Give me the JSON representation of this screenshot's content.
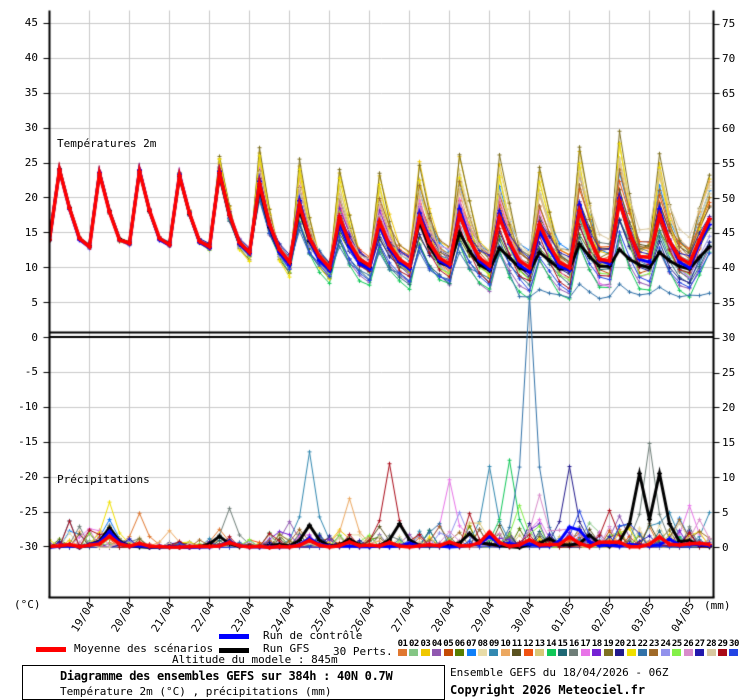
{
  "ui": {
    "panel_temp_label": "Températures 2m",
    "panel_precip_label": "Précipitations",
    "unit_left": "(°C)",
    "unit_right": "(mm)",
    "legend_mean": "Moyenne des scénarios",
    "legend_control": "Run de contrôle",
    "legend_gfs": "Run GFS",
    "legend_perts": "30 Perts.",
    "altitude": "Altitude du modele : 845m",
    "title": "Diagramme des ensembles GEFS sur 384h : 40N 0.7W",
    "subtitle": "Température 2m (°C) , précipitations (mm)",
    "run_info": "Ensemble GEFS du 18/04/2026 - 06Z",
    "copyright": "Copyright 2026 Meteociel.fr"
  },
  "chart_data": {
    "type": "line",
    "title": "Diagramme des ensembles GEFS sur 384h : 40N 0.7W",
    "subtitle": "Température 2m (°C) , précipitations (mm)",
    "x": {
      "start": "18/04 06Z",
      "step_hours": 6,
      "dates": [
        "19/04",
        "20/04",
        "21/04",
        "22/04",
        "23/04",
        "24/04",
        "25/04",
        "26/04",
        "27/04",
        "28/04",
        "29/04",
        "30/04",
        "01/05",
        "02/05",
        "03/05",
        "04/05"
      ]
    },
    "temp_axis": {
      "label": "(°C)",
      "min": -30,
      "max": 45,
      "tick_values": [
        45,
        40,
        35,
        30,
        25,
        20,
        15,
        10,
        5,
        0,
        -5,
        -10,
        -15,
        -20,
        -25,
        -30
      ]
    },
    "precip_axis": {
      "label": "(mm)",
      "min": 0,
      "max": 75,
      "tick_values": [
        75,
        70,
        65,
        60,
        55,
        50,
        45,
        40,
        35,
        30,
        25,
        20,
        15,
        10,
        5,
        0
      ]
    },
    "grid": true,
    "series": {
      "mean": {
        "label": "Moyenne des scénarios",
        "color": "#ff0000",
        "width": 3.5,
        "temp": [
          14.8,
          14.0,
          24.0,
          18.5,
          14.2,
          13.0,
          23.5,
          18.0,
          14.0,
          13.5,
          23.8,
          18.2,
          14.2,
          13.3,
          23.2,
          17.8,
          13.8,
          13.0,
          23.6,
          17.6,
          13.6,
          12.2,
          22.0,
          16.2,
          12.6,
          10.8,
          19.0,
          14.2,
          11.6,
          10.0,
          17.2,
          13.6,
          11.2,
          10.3,
          16.6,
          13.2,
          11.2,
          10.2,
          17.2,
          13.6,
          11.4,
          10.5,
          17.6,
          14.0,
          11.4,
          10.3,
          17.2,
          13.6,
          11.0,
          10.0,
          16.2,
          13.2,
          10.8,
          10.0,
          18.2,
          14.2,
          11.2,
          11.0,
          19.5,
          15.0,
          11.6,
          11.5,
          17.6,
          13.8,
          11.4,
          10.6,
          14.0,
          17.0
        ],
        "precip_events": [
          [
            1.5,
            1.6
          ],
          [
            2.3,
            0.6
          ],
          [
            4.5,
            0.7
          ],
          [
            6.5,
            1.0
          ],
          [
            7.5,
            0.8
          ],
          [
            8.6,
            0.7
          ],
          [
            10.1,
            0.8
          ],
          [
            11.0,
            2.2
          ],
          [
            12.1,
            1.1
          ],
          [
            13.1,
            1.5
          ],
          [
            14.1,
            0.8
          ],
          [
            15.3,
            1.5
          ],
          [
            16.2,
            0.6
          ]
        ]
      },
      "control": {
        "label": "Run de contrôle",
        "color": "#0000ff",
        "width": 3,
        "temp": [
          14.8,
          14.0,
          24.0,
          18.4,
          14.0,
          13.0,
          23.6,
          18.0,
          14.0,
          13.4,
          24.0,
          18.2,
          14.0,
          13.2,
          23.4,
          17.8,
          13.6,
          12.8,
          23.8,
          17.6,
          13.4,
          12.0,
          22.4,
          16.0,
          12.2,
          10.4,
          19.6,
          14.0,
          11.0,
          9.6,
          16.4,
          13.0,
          10.6,
          9.8,
          16.0,
          12.8,
          10.8,
          9.8,
          17.8,
          13.8,
          11.0,
          10.2,
          18.4,
          14.2,
          11.0,
          9.8,
          17.8,
          13.4,
          10.4,
          9.4,
          15.2,
          12.6,
          10.2,
          9.6,
          19.0,
          14.4,
          11.0,
          10.6,
          20.0,
          15.0,
          11.2,
          10.8,
          18.4,
          13.8,
          10.8,
          10.0,
          13.5,
          16.2
        ],
        "precip_events": [
          [
            1.5,
            2.3
          ],
          [
            4.4,
            0.8
          ],
          [
            6.5,
            1.3
          ],
          [
            9.0,
            0.6
          ],
          [
            11.1,
            1.6
          ],
          [
            13.0,
            2.9
          ],
          [
            13.3,
            2.5
          ],
          [
            15.4,
            1.2
          ],
          [
            16.0,
            0.5
          ]
        ]
      },
      "gfs": {
        "label": "Run GFS",
        "color": "#000000",
        "width": 3,
        "temp": [
          14.8,
          14.0,
          24.1,
          18.6,
          14.2,
          13.1,
          23.6,
          18.1,
          14.1,
          13.5,
          23.9,
          18.1,
          14.1,
          13.3,
          23.1,
          17.7,
          13.7,
          13.0,
          23.5,
          17.5,
          13.4,
          12.1,
          21.6,
          15.8,
          12.2,
          10.6,
          18.4,
          13.8,
          11.2,
          9.8,
          16.8,
          13.2,
          10.8,
          10.0,
          16.2,
          12.8,
          10.8,
          10.0,
          16.6,
          13.0,
          10.8,
          10.2,
          15.0,
          12.4,
          10.4,
          9.6,
          12.8,
          11.4,
          10.0,
          9.4,
          12.2,
          11.0,
          9.8,
          9.8,
          13.4,
          11.6,
          10.2,
          10.2,
          12.6,
          11.2,
          10.4,
          10.0,
          12.2,
          11.0,
          10.2,
          9.8,
          11.5,
          13.0
        ],
        "precip_events": [
          [
            1.5,
            2.8
          ],
          [
            4.35,
            1.6
          ],
          [
            6.55,
            3.2
          ],
          [
            7.5,
            1.2
          ],
          [
            8.75,
            3.4
          ],
          [
            10.4,
            2.0
          ],
          [
            12.5,
            1.3
          ],
          [
            13.6,
            1.8
          ],
          [
            14.8,
            10.6
          ],
          [
            15.1,
            4.0
          ],
          [
            15.35,
            10.6
          ],
          [
            16.1,
            1.0
          ]
        ]
      }
    },
    "members": [
      {
        "n": "01",
        "c": "#e07830",
        "a": 1.05,
        "o": 1.2
      },
      {
        "n": "02",
        "c": "#84c684",
        "a": 0.95,
        "o": -1.0
      },
      {
        "n": "03",
        "c": "#f0c800",
        "a": 1.4,
        "o": 2.8
      },
      {
        "n": "04",
        "c": "#9058b0",
        "a": 0.9,
        "o": -2.2
      },
      {
        "n": "05",
        "c": "#c44a04",
        "a": 1.1,
        "o": 0.6
      },
      {
        "n": "06",
        "c": "#587e00",
        "a": 0.85,
        "o": -3.2
      },
      {
        "n": "07",
        "c": "#1080f8",
        "a": 1.15,
        "o": 2.0
      },
      {
        "n": "08",
        "c": "#e8dca8",
        "a": 1.35,
        "o": 3.5
      },
      {
        "n": "09",
        "c": "#3288b0",
        "a": 0.9,
        "o": -1.6,
        "pf": 1.4
      },
      {
        "n": "10",
        "c": "#eca860",
        "a": 1.3,
        "o": 1.8
      },
      {
        "n": "11",
        "c": "#5a5220",
        "a": 1.0,
        "o": -0.6
      },
      {
        "n": "12",
        "c": "#f05210",
        "a": 1.05,
        "o": 0.3
      },
      {
        "n": "13",
        "c": "#d8c878",
        "a": 1.35,
        "o": 2.4
      },
      {
        "n": "14",
        "c": "#10c858",
        "a": 0.95,
        "o": -2.8
      },
      {
        "n": "15",
        "c": "#1e6874",
        "a": 0.9,
        "o": -3.8
      },
      {
        "n": "16",
        "c": "#6e7e78",
        "a": 0.9,
        "o": 1.0,
        "pf": 1.4
      },
      {
        "n": "17",
        "c": "#e874e8",
        "a": 1.2,
        "o": -1.2
      },
      {
        "n": "18",
        "c": "#7422d4",
        "a": 1.05,
        "o": 0.8
      },
      {
        "n": "19",
        "c": "#7e7020",
        "a": 1.5,
        "o": 2.2
      },
      {
        "n": "20",
        "c": "#221a8c",
        "a": 0.9,
        "o": -2.0
      },
      {
        "n": "21",
        "c": "#f0e000",
        "a": 1.45,
        "o": 3.2
      },
      {
        "n": "22",
        "c": "#3272a8",
        "a": 0.8,
        "o": -4.0,
        "la": 11.5,
        "lv": 6.4,
        "pf": 1.4
      },
      {
        "n": "23",
        "c": "#a06a28",
        "a": 1.15,
        "o": 1.4
      },
      {
        "n": "24",
        "c": "#9292ec",
        "a": 1.0,
        "o": -0.2
      },
      {
        "n": "25",
        "c": "#84f048",
        "a": 1.1,
        "o": -1.4
      },
      {
        "n": "26",
        "c": "#d88cca",
        "a": 1.0,
        "o": 0.0
      },
      {
        "n": "27",
        "c": "#2218ac",
        "a": 0.95,
        "o": -0.9
      },
      {
        "n": "28",
        "c": "#d8c8a0",
        "a": 1.15,
        "o": 2.6
      },
      {
        "n": "29",
        "c": "#aa0a18",
        "a": 1.05,
        "o": -0.4,
        "pf": 1.4
      },
      {
        "n": "30",
        "c": "#2244e4",
        "a": 0.9,
        "o": -2.4
      }
    ],
    "member_precip_spikes": [
      [
        21,
        1.5,
        6.5
      ],
      [
        7,
        1.45,
        4.0
      ],
      [
        16,
        1.55,
        3.2
      ],
      [
        30,
        1.6,
        2.6
      ],
      [
        3,
        1.5,
        3.0
      ],
      [
        1,
        2.3,
        4.9
      ],
      [
        10,
        3.05,
        2.4
      ],
      [
        16,
        4.5,
        5.6
      ],
      [
        1,
        4.3,
        2.6
      ],
      [
        4,
        6.05,
        3.7
      ],
      [
        23,
        6.3,
        2.6
      ],
      [
        9,
        6.5,
        13.7
      ],
      [
        5,
        6.6,
        3.0
      ],
      [
        10,
        7.55,
        7.0
      ],
      [
        3,
        7.3,
        2.5
      ],
      [
        29,
        8.5,
        12.0
      ],
      [
        11,
        8.3,
        3.0
      ],
      [
        17,
        10.0,
        9.7
      ],
      [
        24,
        10.3,
        5.0
      ],
      [
        23,
        9.8,
        3.0
      ],
      [
        9,
        11.0,
        11.6
      ],
      [
        14,
        11.55,
        12.5
      ],
      [
        25,
        11.7,
        6.0
      ],
      [
        13,
        10.8,
        3.5
      ],
      [
        22,
        12.05,
        36.0
      ],
      [
        26,
        12.3,
        7.5
      ],
      [
        17,
        12.2,
        4.0
      ],
      [
        20,
        13.05,
        11.6
      ],
      [
        30,
        13.25,
        5.2
      ],
      [
        2,
        13.5,
        3.5
      ],
      [
        29,
        14.05,
        5.3
      ],
      [
        4,
        14.25,
        4.5
      ],
      [
        10,
        14.5,
        3.0
      ],
      [
        16,
        15.05,
        14.9
      ],
      [
        9,
        15.5,
        5.0
      ],
      [
        7,
        15.65,
        4.2
      ],
      [
        23,
        15.85,
        4.0
      ],
      [
        17,
        15.9,
        6.0
      ],
      [
        28,
        15.7,
        3.5
      ],
      [
        26,
        16.3,
        4.0
      ],
      [
        9,
        16.4,
        5.0
      ]
    ],
    "precip_activity": [
      0.6,
      1.3,
      0.7,
      0.35,
      0.5,
      0.6,
      1.1,
      1.0,
      0.9,
      0.9,
      1.3,
      1.6,
      1.6,
      1.3,
      1.6,
      1.6,
      1.2
    ]
  }
}
